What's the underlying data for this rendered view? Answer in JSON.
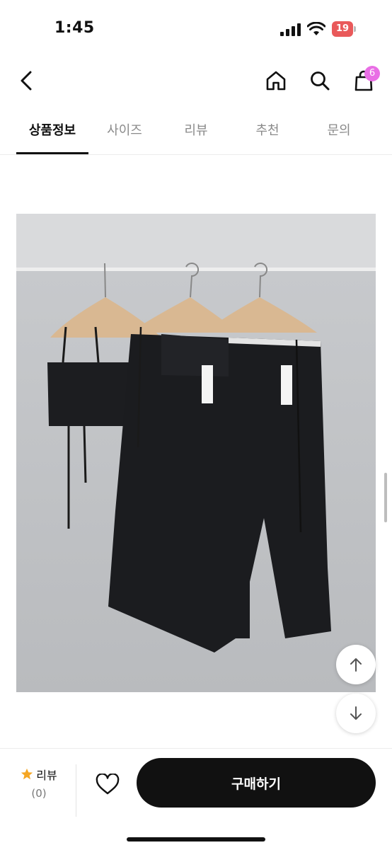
{
  "status": {
    "time": "1:45",
    "battery": "19"
  },
  "nav": {
    "back_icon": "chevron-left-icon",
    "home_icon": "home-icon",
    "search_icon": "search-icon",
    "cart_icon": "shopping-bag-icon",
    "cart_badge": "6",
    "badge_color": "#e96ee5"
  },
  "tabs": [
    {
      "label": "상품정보",
      "active": true
    },
    {
      "label": "사이즈",
      "active": false
    },
    {
      "label": "리뷰",
      "active": false
    },
    {
      "label": "추천",
      "active": false
    },
    {
      "label": "문의",
      "active": false
    }
  ],
  "product_image": {
    "icon": "product-photo-icon"
  },
  "floating": {
    "up_icon": "arrow-up-icon",
    "down_icon": "arrow-down-icon"
  },
  "bottom": {
    "review_label": "리뷰",
    "review_count": "(0)",
    "star_color": "#f5a623",
    "heart_icon": "heart-icon",
    "buy_label": "구매하기"
  }
}
